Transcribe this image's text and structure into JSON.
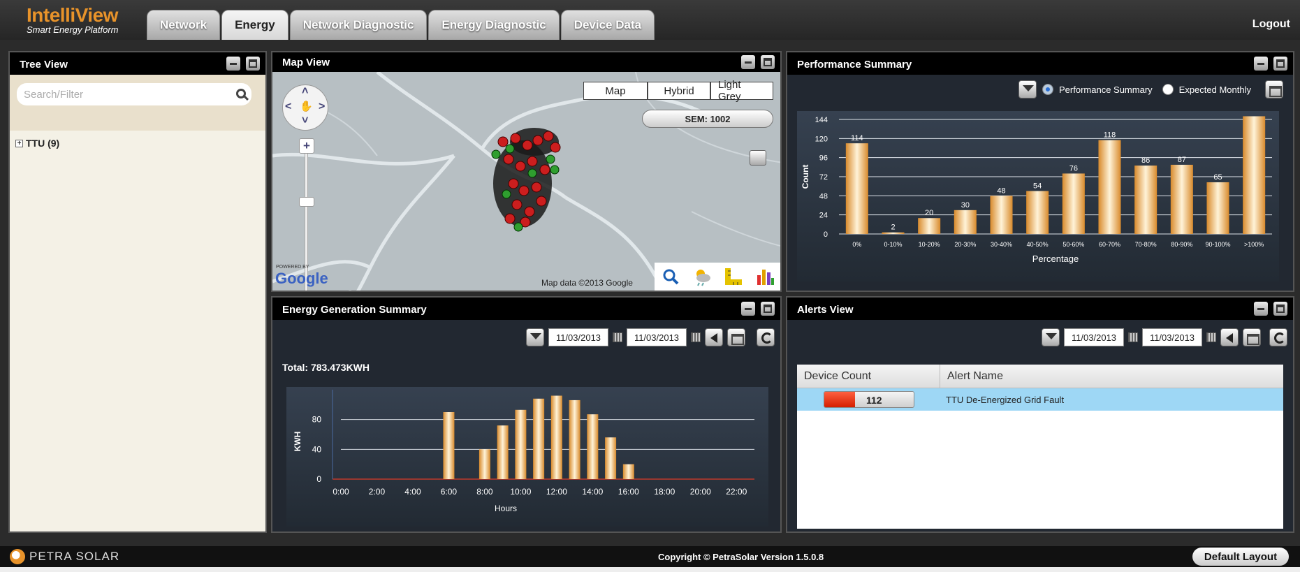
{
  "app": {
    "title": "IntelliView",
    "subtitle": "Smart Energy Platform",
    "logout": "Logout"
  },
  "tabs": [
    {
      "label": "Network",
      "active": false
    },
    {
      "label": "Energy",
      "active": true
    },
    {
      "label": "Network Diagnostic",
      "active": false
    },
    {
      "label": "Energy Diagnostic",
      "active": false
    },
    {
      "label": "Device Data",
      "active": false
    }
  ],
  "tree": {
    "title": "Tree View",
    "search_placeholder": "Search/Filter",
    "root_label": "TTU (9)"
  },
  "map": {
    "title": "Map View",
    "types": [
      "Map",
      "Hybrid",
      "Light Grey"
    ],
    "sem_label": "SEM: 1002",
    "powered_by": "POWERED BY",
    "google": "Google",
    "data_credit": "Map data ©2013  Google"
  },
  "performance": {
    "title": "Performance Summary",
    "radio_perf": "Performance Summary",
    "radio_expected": "Expected Monthly",
    "chart_data": {
      "type": "bar",
      "categories": [
        "0%",
        "0-10%",
        "10-20%",
        "20-30%",
        "30-40%",
        "40-50%",
        "50-60%",
        "60-70%",
        "70-80%",
        "80-90%",
        "90-100%",
        ">100%"
      ],
      "values": [
        114,
        2,
        20,
        30,
        48,
        54,
        76,
        118,
        86,
        87,
        65,
        148
      ],
      "data_labels": [
        "114",
        "2",
        "20",
        "30",
        "48",
        "54",
        "76",
        "118",
        "86",
        "87",
        "65",
        ""
      ],
      "xlabel": "Percentage",
      "ylabel": "Count",
      "ylim": [
        0,
        144
      ],
      "yticks": [
        0,
        24,
        48,
        72,
        96,
        120,
        144
      ],
      "grid": true,
      "bar_color": "#e8a84a"
    }
  },
  "energy": {
    "title": "Energy Generation Summary",
    "date_from": "11/03/2013",
    "date_to": "11/03/2013",
    "total_label": "Total:",
    "total_value": "783.473KWH",
    "chart_data": {
      "type": "bar",
      "x": [
        6,
        8,
        9,
        10,
        11,
        12,
        13,
        14,
        15,
        16
      ],
      "values": [
        90,
        40,
        72,
        93,
        108,
        112,
        106,
        87,
        56,
        20
      ],
      "xticks": [
        "0:00",
        "2:00",
        "4:00",
        "6:00",
        "8:00",
        "10:00",
        "12:00",
        "14:00",
        "16:00",
        "18:00",
        "20:00",
        "22:00"
      ],
      "xlim": [
        0,
        23
      ],
      "xlabel": "Hours",
      "ylabel": "KWH",
      "ylim": [
        0,
        120
      ],
      "yticks": [
        0,
        40,
        80
      ],
      "grid": true,
      "bar_color": "#e8a84a"
    }
  },
  "alerts": {
    "title": "Alerts View",
    "date_from": "11/03/2013",
    "date_to": "11/03/2013",
    "columns": [
      "Device Count",
      "Alert Name"
    ],
    "rows": [
      {
        "count": "112",
        "name": "TTU De-Energized Grid Fault"
      }
    ]
  },
  "footer": {
    "brand": "PETRA SOLAR",
    "copyright": "Copyright © PetraSolar  Version 1.5.0.8",
    "default_layout": "Default Layout"
  }
}
